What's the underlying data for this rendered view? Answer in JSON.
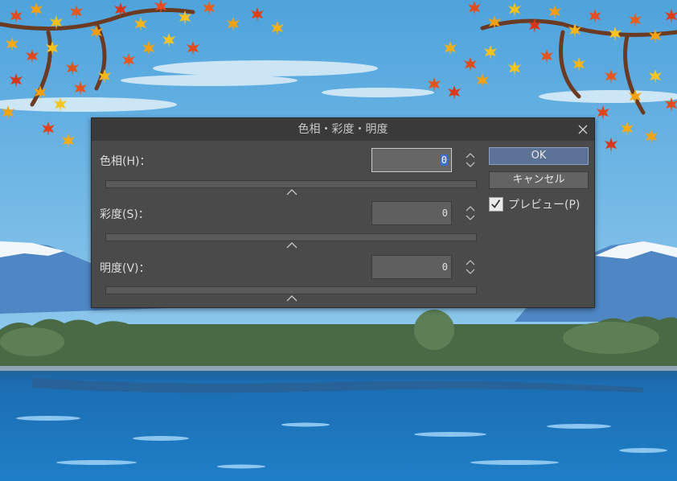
{
  "dialog": {
    "title": "色相・彩度・明度",
    "rows": [
      {
        "label": "色相(H)：",
        "value": "0"
      },
      {
        "label": "彩度(S)：",
        "value": "0"
      },
      {
        "label": "明度(V)：",
        "value": "0"
      }
    ],
    "ok_label": "OK",
    "cancel_label": "キャンセル",
    "preview_label": "プレビュー(P)",
    "preview_checked": true
  },
  "colors": {
    "dialog_bg": "#4a4a4a",
    "titlebar_bg": "#3a3a3a",
    "ok_button": "#5c7196",
    "sky": "#6fb6e6",
    "lake": "#1d73b8"
  }
}
